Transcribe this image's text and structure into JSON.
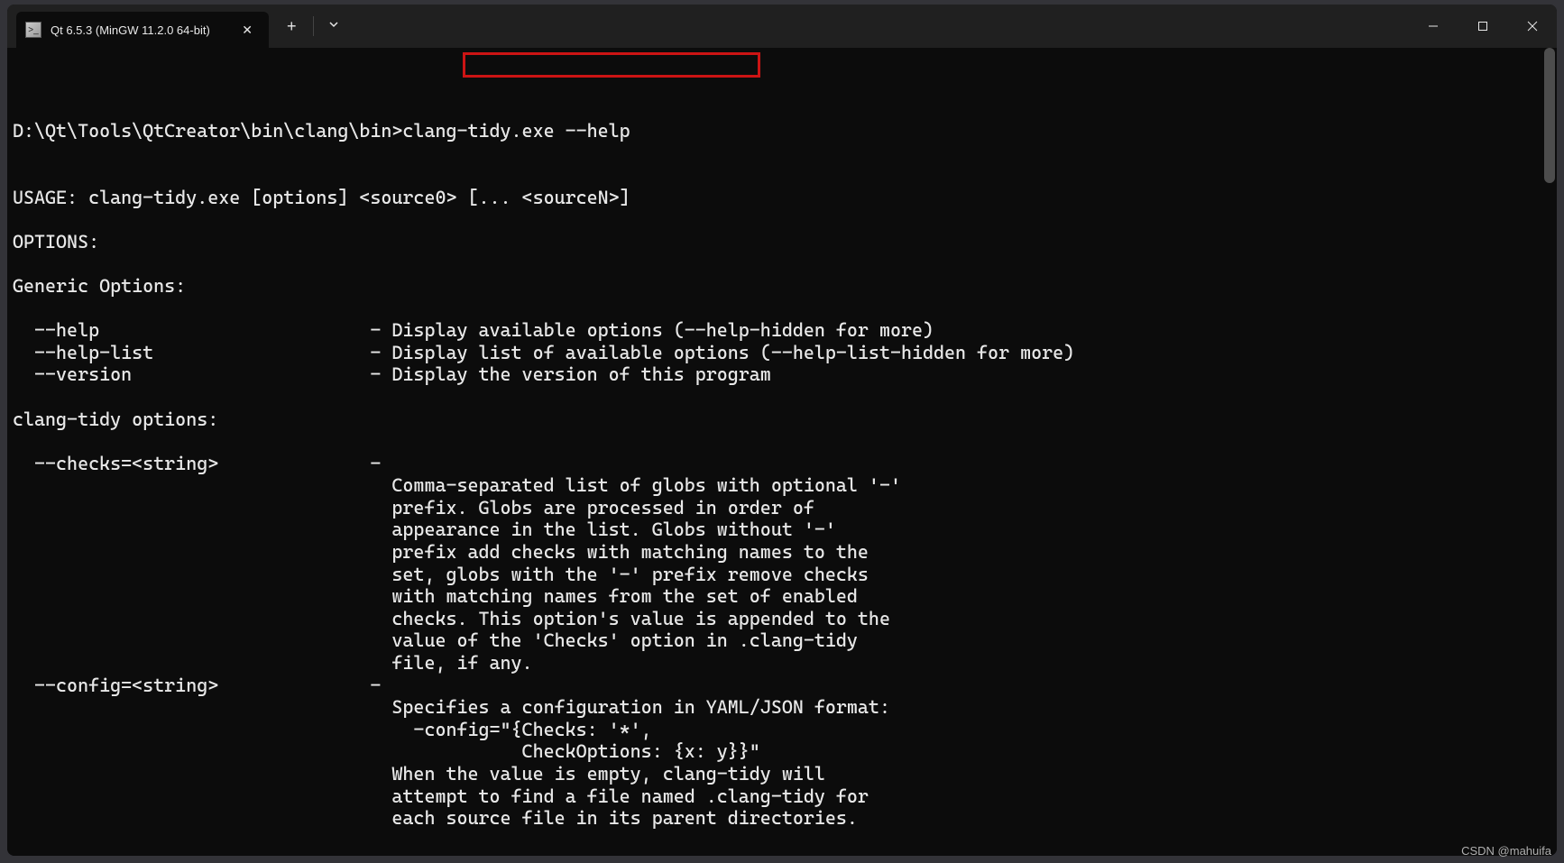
{
  "tab": {
    "title": "Qt 6.5.3 (MinGW 11.2.0 64-bit)",
    "icon_glyph": ">_"
  },
  "window_controls": {
    "minimize": "—",
    "maximize": "▢",
    "close": "✕"
  },
  "terminal": {
    "prompt_path": "D:\\Qt\\Tools\\QtCreator\\bin\\clang\\bin>",
    "command": "clang-tidy.exe --help",
    "lines": [
      "USAGE: clang-tidy.exe [options] <source0> [... <sourceN>]",
      "",
      "OPTIONS:",
      "",
      "Generic Options:",
      "",
      "  --help                         - Display available options (--help-hidden for more)",
      "  --help-list                    - Display list of available options (--help-list-hidden for more)",
      "  --version                      - Display the version of this program",
      "",
      "clang-tidy options:",
      "",
      "  --checks=<string>              -",
      "                                   Comma-separated list of globs with optional '-'",
      "                                   prefix. Globs are processed in order of",
      "                                   appearance in the list. Globs without '-'",
      "                                   prefix add checks with matching names to the",
      "                                   set, globs with the '-' prefix remove checks",
      "                                   with matching names from the set of enabled",
      "                                   checks. This option's value is appended to the",
      "                                   value of the 'Checks' option in .clang-tidy",
      "                                   file, if any.",
      "  --config=<string>              -",
      "                                   Specifies a configuration in YAML/JSON format:",
      "                                     -config=\"{Checks: '*',",
      "                                               CheckOptions: {x: y}}\"",
      "                                   When the value is empty, clang-tidy will",
      "                                   attempt to find a file named .clang-tidy for",
      "                                   each source file in its parent directories."
    ]
  },
  "watermark": "CSDN @mahuifa"
}
